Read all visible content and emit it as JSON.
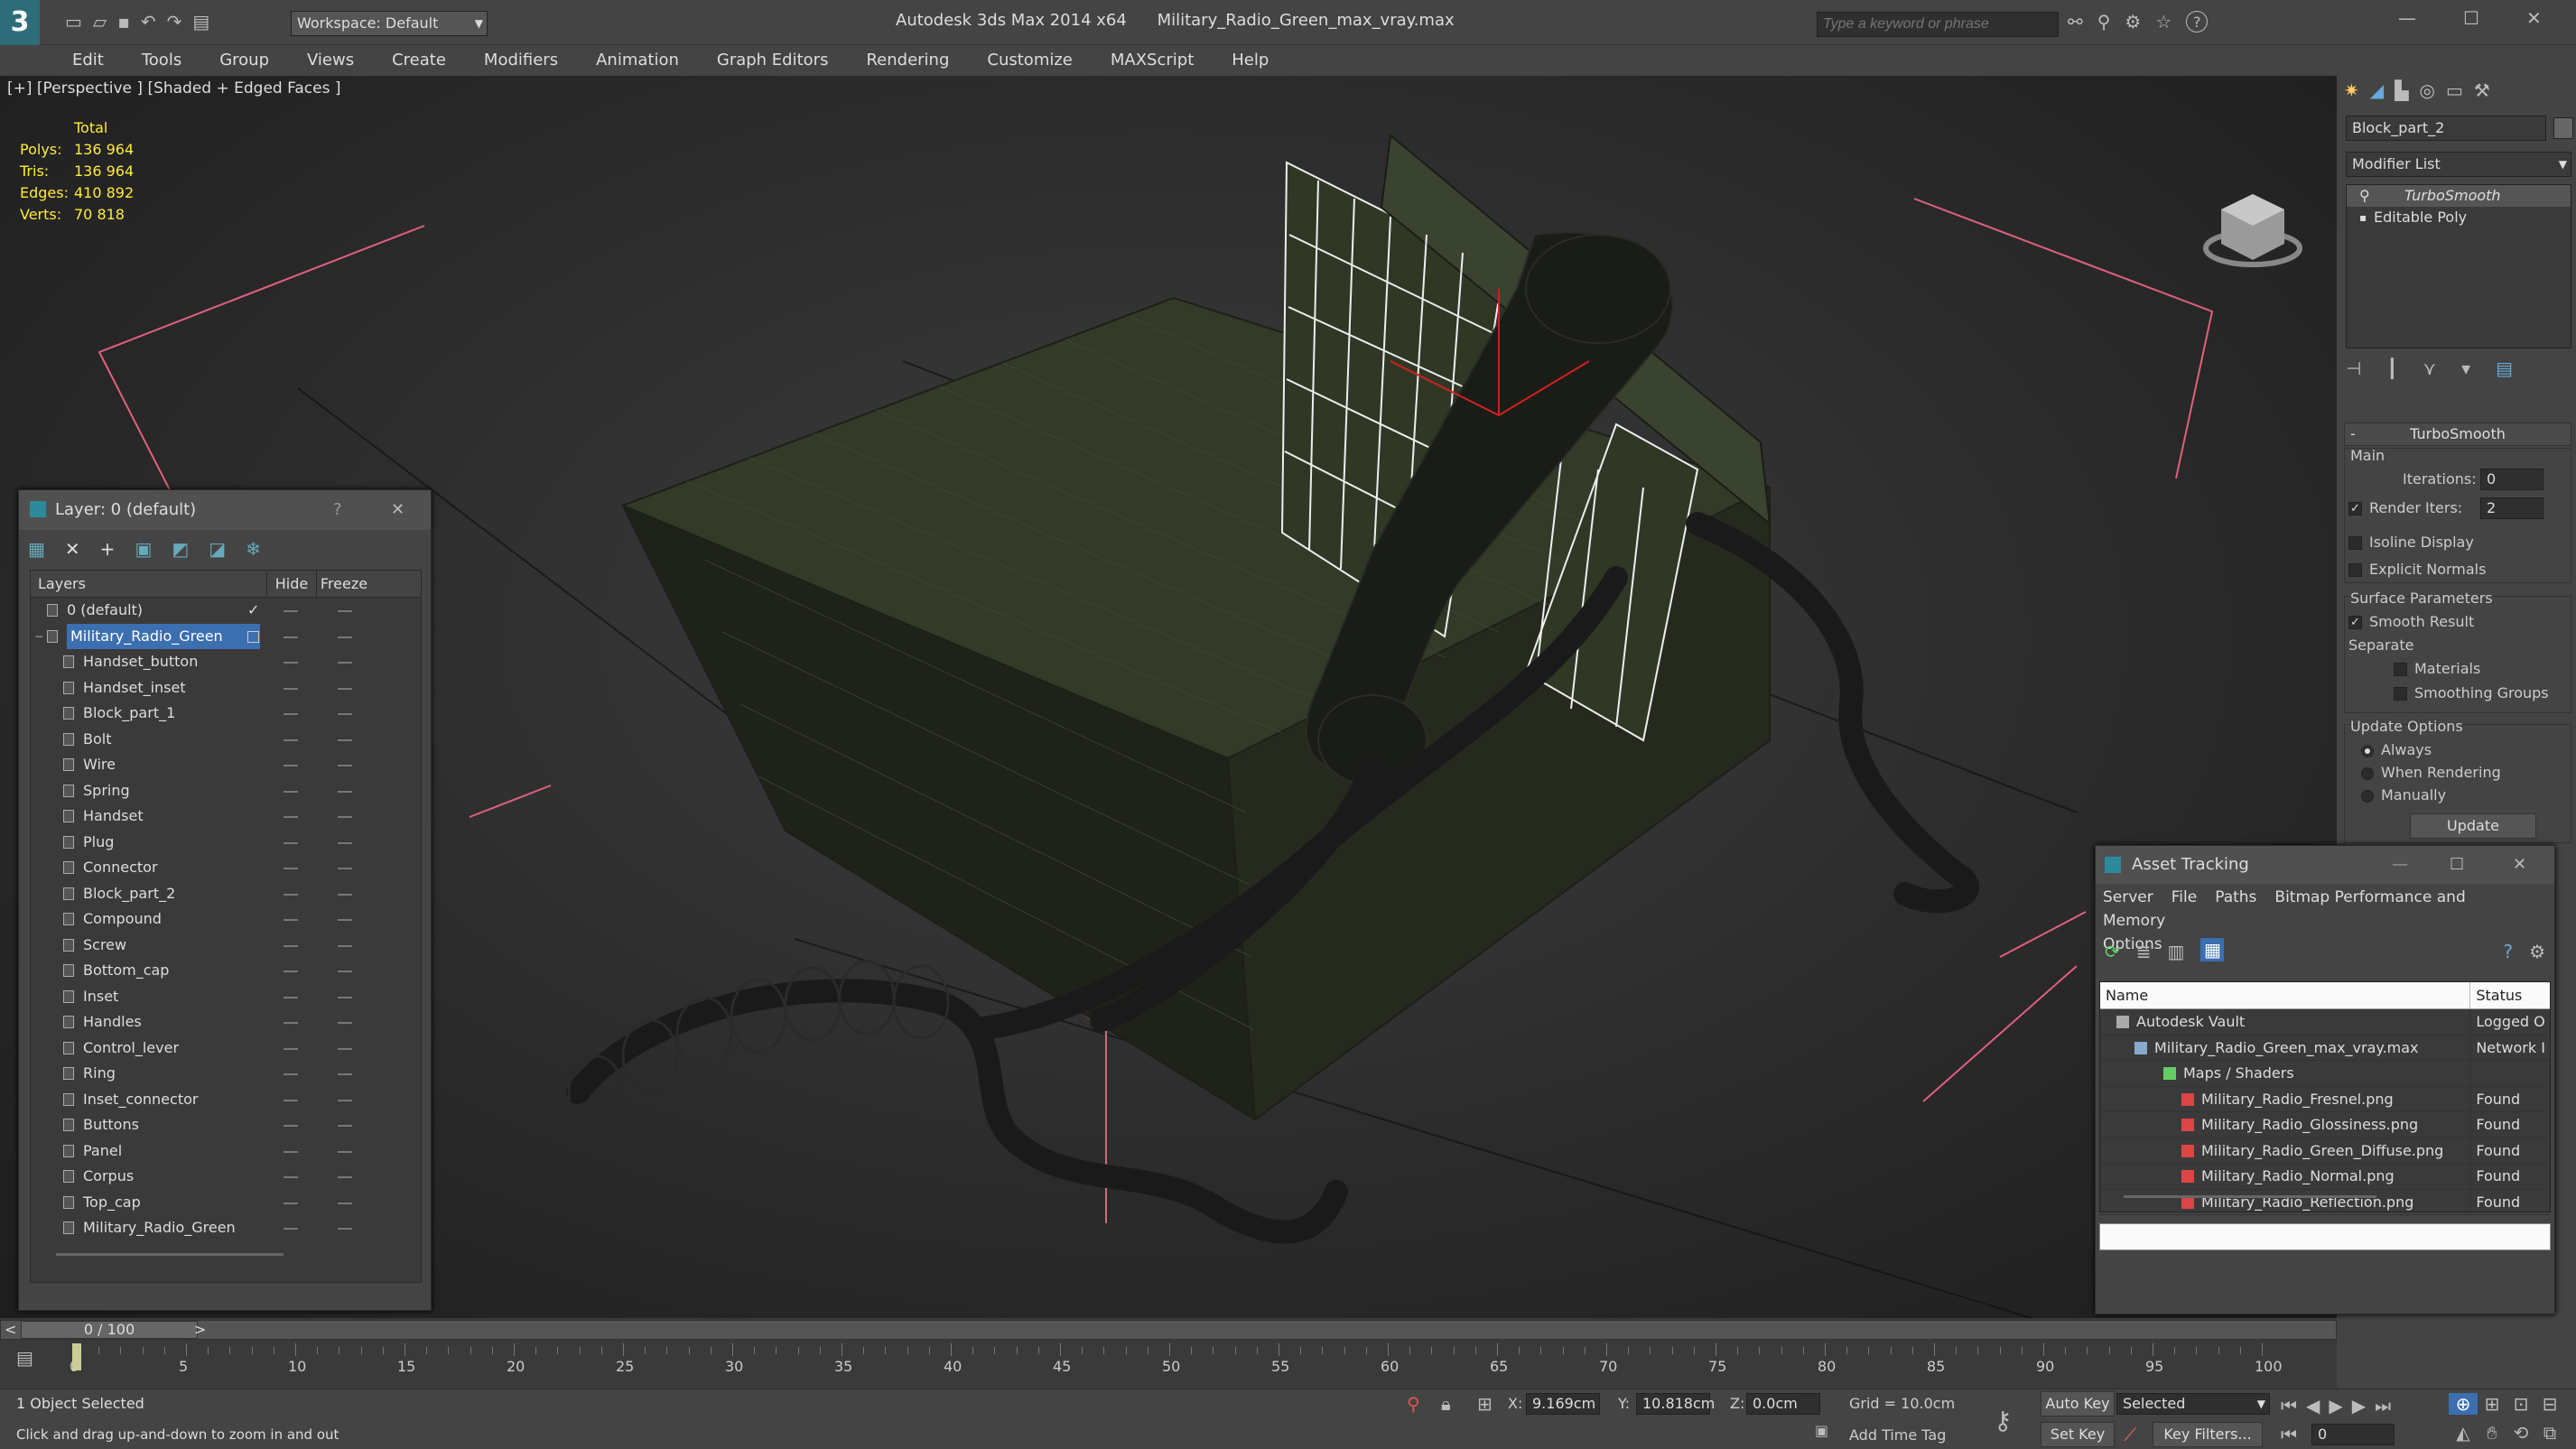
{
  "app": {
    "title_app": "Autodesk 3ds Max  2014 x64",
    "title_file": "Military_Radio_Green_max_vray.max",
    "workspace": "Workspace: Default",
    "search_placeholder": "Type a keyword or phrase",
    "help_label": "?",
    "logo_glyph": "3"
  },
  "menu": [
    "Edit",
    "Tools",
    "Group",
    "Views",
    "Create",
    "Modifiers",
    "Animation",
    "Graph Editors",
    "Rendering",
    "Customize",
    "MAXScript",
    "Help"
  ],
  "viewport": {
    "label": "[+] [Perspective ] [Shaded + Edged Faces ]",
    "stats_header": "Total",
    "stats": [
      {
        "label": "Polys:",
        "value": "136 964"
      },
      {
        "label": "Tris:",
        "value": "136 964"
      },
      {
        "label": "Edges:",
        "value": "410 892"
      },
      {
        "label": "Verts:",
        "value": "70 818"
      }
    ]
  },
  "layer_panel": {
    "title": "Layer: 0 (default)",
    "help": "?",
    "col_layers": "Layers",
    "col_hide": "Hide",
    "col_freeze": "Freeze",
    "layers": [
      {
        "name": "0 (default)",
        "level": 0,
        "check": "✓"
      },
      {
        "name": "Military_Radio_Green",
        "level": 0,
        "selected": true
      },
      {
        "name": "Handset_button",
        "level": 1
      },
      {
        "name": "Handset_inset",
        "level": 1
      },
      {
        "name": "Block_part_1",
        "level": 1
      },
      {
        "name": "Bolt",
        "level": 1
      },
      {
        "name": "Wire",
        "level": 1
      },
      {
        "name": "Spring",
        "level": 1
      },
      {
        "name": "Handset",
        "level": 1
      },
      {
        "name": "Plug",
        "level": 1
      },
      {
        "name": "Connector",
        "level": 1
      },
      {
        "name": "Block_part_2",
        "level": 1
      },
      {
        "name": "Compound",
        "level": 1
      },
      {
        "name": "Screw",
        "level": 1
      },
      {
        "name": "Bottom_cap",
        "level": 1
      },
      {
        "name": "Inset",
        "level": 1
      },
      {
        "name": "Handles",
        "level": 1
      },
      {
        "name": "Control_lever",
        "level": 1
      },
      {
        "name": "Ring",
        "level": 1
      },
      {
        "name": "Inset_connector",
        "level": 1
      },
      {
        "name": "Buttons",
        "level": 1
      },
      {
        "name": "Panel",
        "level": 1
      },
      {
        "name": "Corpus",
        "level": 1
      },
      {
        "name": "Top_cap",
        "level": 1
      },
      {
        "name": "Military_Radio_Green",
        "level": 1
      }
    ]
  },
  "command_panel": {
    "object_name": "Block_part_2",
    "modifier_list": "Modifier List",
    "stack": [
      "TurboSmooth",
      "Editable Poly"
    ],
    "rollout_title": "TurboSmooth",
    "main_label": "Main",
    "iterations_label": "Iterations:",
    "iterations_value": "0",
    "render_iters_label": "Render Iters:",
    "render_iters_value": "2",
    "isoline_label": "Isoline Display",
    "explicit_normals_label": "Explicit Normals",
    "surface_params_label": "Surface Parameters",
    "smooth_result_label": "Smooth Result",
    "separate_label": "Separate",
    "materials_label": "Materials",
    "smoothing_groups_label": "Smoothing Groups",
    "update_options_label": "Update Options",
    "always_label": "Always",
    "when_rendering_label": "When Rendering",
    "manually_label": "Manually",
    "update_button": "Update"
  },
  "asset_panel": {
    "title": "Asset Tracking",
    "menus": [
      "Server",
      "File",
      "Paths",
      "Bitmap Performance and Memory"
    ],
    "menu_options": "Options",
    "col_name": "Name",
    "col_status": "Status",
    "rows": [
      {
        "name": "Autodesk Vault",
        "status": "Logged O",
        "level": 1
      },
      {
        "name": "Military_Radio_Green_max_vray.max",
        "status": "Network I",
        "level": 2
      },
      {
        "name": "Maps / Shaders",
        "status": "",
        "level": 3
      },
      {
        "name": "Military_Radio_Fresnel.png",
        "status": "Found",
        "level": 4
      },
      {
        "name": "Military_Radio_Glossiness.png",
        "status": "Found",
        "level": 4
      },
      {
        "name": "Military_Radio_Green_Diffuse.png",
        "status": "Found",
        "level": 4
      },
      {
        "name": "Military_Radio_Normal.png",
        "status": "Found",
        "level": 4
      },
      {
        "name": "Military_Radio_Reflection.png",
        "status": "Found",
        "level": 4
      }
    ]
  },
  "timeline": {
    "frame_display": "0 / 100",
    "prev": "<",
    "next": ">",
    "current_frame": 0,
    "frame_max": 100,
    "ticks": [
      "0",
      "5",
      "10",
      "15",
      "20",
      "25",
      "30",
      "35",
      "40",
      "45",
      "50",
      "55",
      "60",
      "65",
      "70",
      "75",
      "80",
      "85",
      "90",
      "95",
      "100"
    ]
  },
  "status": {
    "selection": "1 Object Selected",
    "prompt": "Click and drag up-and-down to zoom in and out",
    "x_label": "X:",
    "x_value": "9.169cm",
    "y_label": "Y:",
    "y_value": "10.818cm",
    "z_label": "Z:",
    "z_value": "0.0cm",
    "grid": "Grid = 10.0cm",
    "add_time_tag": "Add Time Tag",
    "auto_key": "Auto Key",
    "set_key": "Set Key",
    "selected_dropdown": "Selected",
    "key_filters": "Key Filters...",
    "frame_field": "0"
  }
}
